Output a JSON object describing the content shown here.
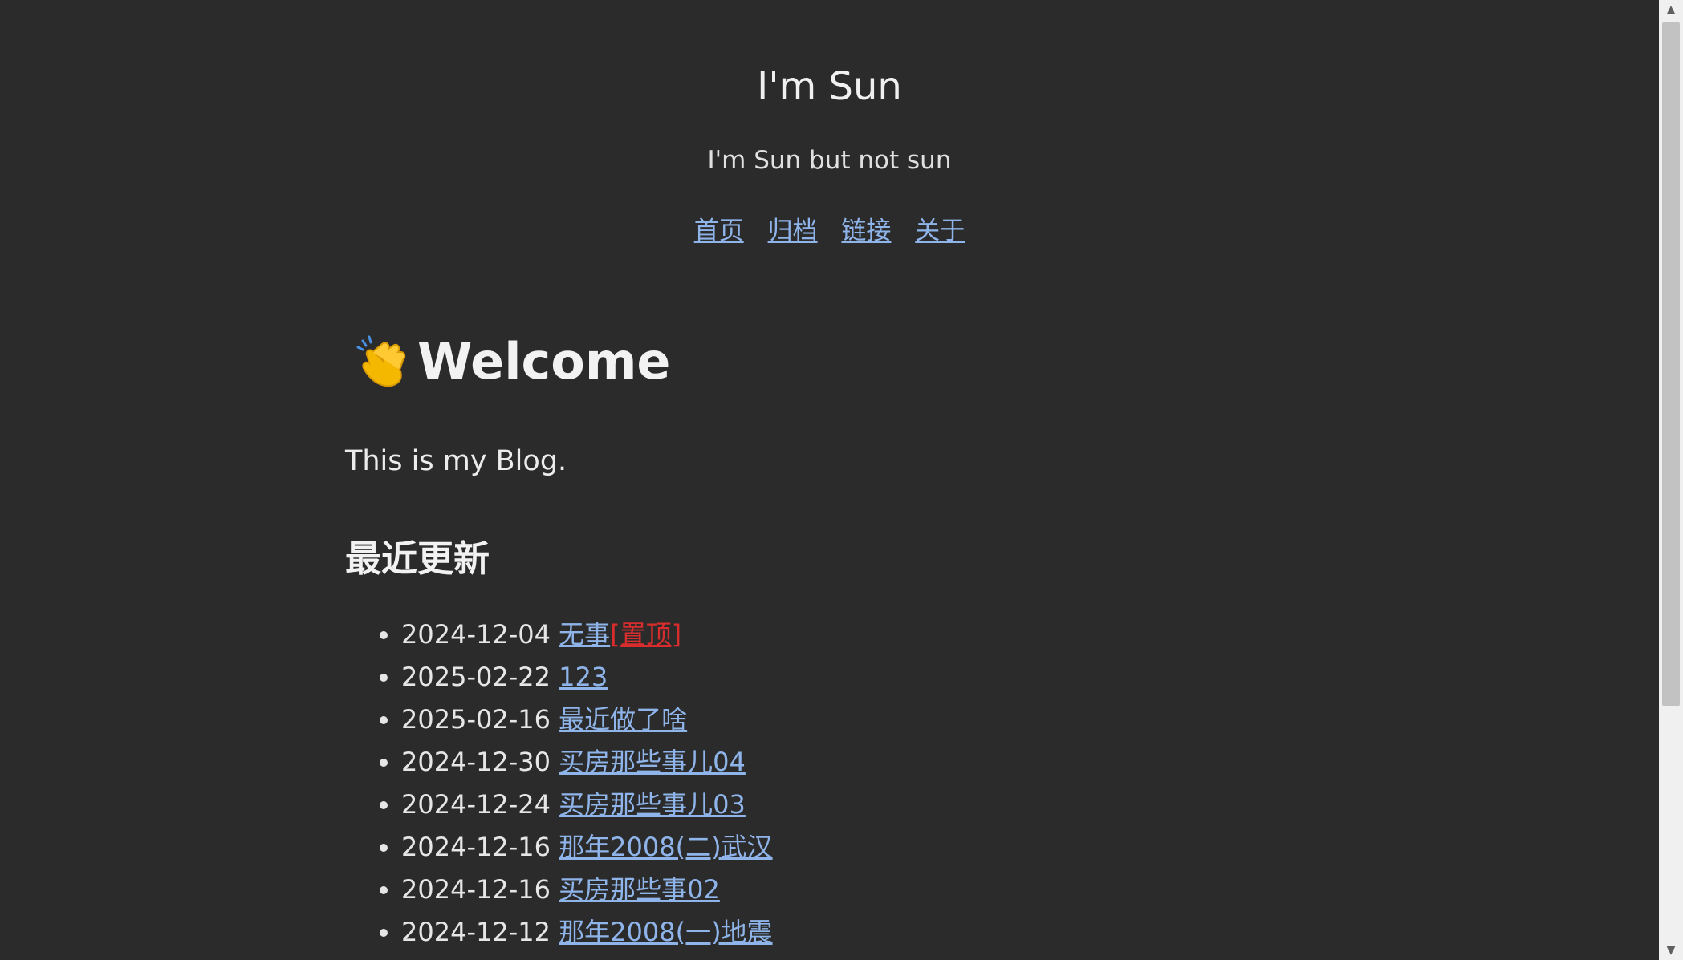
{
  "site": {
    "title": "I'm Sun",
    "subtitle": "I'm Sun but not sun"
  },
  "nav": [
    {
      "label": "首页"
    },
    {
      "label": "归档"
    },
    {
      "label": "链接"
    },
    {
      "label": "关于"
    }
  ],
  "main": {
    "welcome_icon": "clapping-hands-icon",
    "welcome_title": "Welcome",
    "intro": "This is my Blog.",
    "recent_heading": "最近更新",
    "posts": [
      {
        "date": "2024-12-04",
        "title": "无事",
        "badge": "[置顶]"
      },
      {
        "date": "2025-02-22",
        "title": "123"
      },
      {
        "date": "2025-02-16",
        "title": "最近做了啥"
      },
      {
        "date": "2024-12-30",
        "title": "买房那些事儿04"
      },
      {
        "date": "2024-12-24",
        "title": "买房那些事儿03"
      },
      {
        "date": "2024-12-16",
        "title": "那年2008(二)武汉"
      },
      {
        "date": "2024-12-16",
        "title": "买房那些事02"
      },
      {
        "date": "2024-12-12",
        "title": "那年2008(一)地震"
      }
    ]
  },
  "colors": {
    "background": "#2b2b2b",
    "link": "#8fb4ea",
    "pin_badge": "#d92d2d"
  }
}
